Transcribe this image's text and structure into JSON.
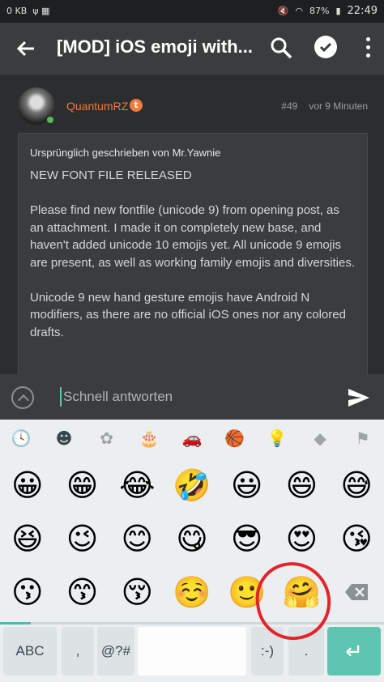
{
  "status_bar": {
    "data_rate": "0 KB",
    "battery": "87%",
    "time": "22:49"
  },
  "app_bar": {
    "title": "[MOD] iOS emoji with..."
  },
  "post": {
    "author": "QuantumRZ",
    "badge": "t",
    "number": "#49",
    "time": "vor 9 Minuten",
    "quote_header": "Ursprünglich geschrieben von Mr.Yawnie",
    "paragraphs": [
      "NEW FONT FILE RELEASED",
      "Please find new fontfile (unicode 9) from opening post, as an attachment. I made it on completely new base, and haven't added unicode 10 emojis yet. All unicode 9 emojis are present, as well as working family emojis and diversities.",
      "Unicode 9 new hand gesture emojis have Android N modifiers, as there are no official iOS ones nor any colored drafts."
    ]
  },
  "reply": {
    "placeholder": "Schnell antworten"
  },
  "keyboard": {
    "categories": [
      "🕓",
      "☻",
      "✿",
      "🎂",
      "🚗",
      "🏀",
      "💡",
      "◆",
      "⚑"
    ],
    "emoji_rows": [
      [
        "😀",
        "😁",
        "😂",
        "🤣",
        "😃",
        "😄",
        "😅"
      ],
      [
        "😆",
        "😉",
        "😊",
        "😋",
        "😎",
        "😍",
        "😘"
      ],
      [
        "😗",
        "😙",
        "😚",
        "☺️",
        "🙂",
        "🤗"
      ]
    ],
    "keys": {
      "abc": "ABC",
      "comma": ",",
      "symbols": "@?#",
      "emoticon": ":-)",
      "period": ".",
      "enter": "↵"
    }
  },
  "colors": {
    "accent": "#5ec6b0",
    "author": "#f07b3f",
    "highlight_circle": "#e3242b"
  }
}
